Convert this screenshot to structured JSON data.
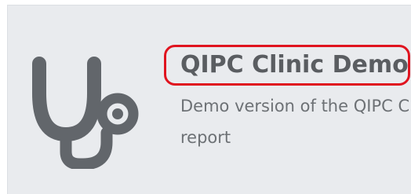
{
  "card": {
    "title": "QIPC Clinic Demo",
    "description": "Demo version of the QIPC Clinic report",
    "icon": "stethoscope-icon"
  },
  "colors": {
    "card_background": "#e9ebee",
    "icon": "#62666b",
    "title_text": "#5a5d61",
    "description_text": "#6d7175",
    "highlight_annotation": "#e0141f"
  }
}
